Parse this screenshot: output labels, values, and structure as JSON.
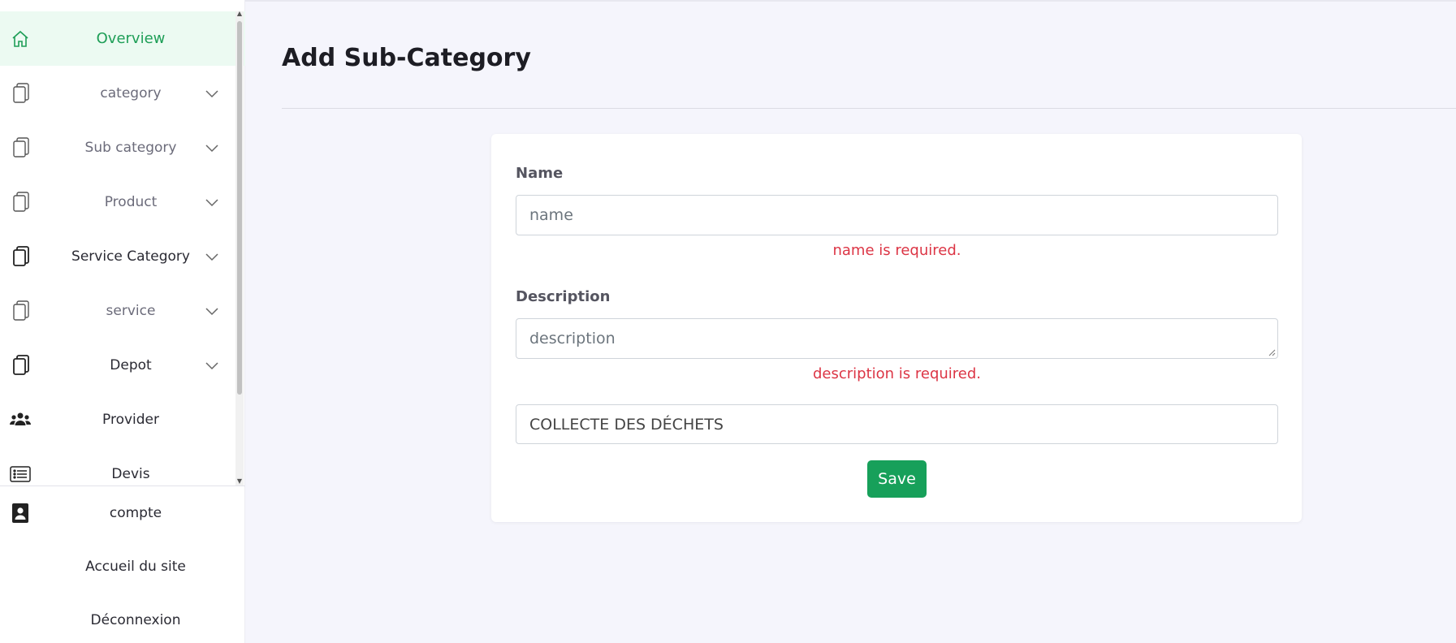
{
  "sidebar": {
    "items": [
      {
        "label": "Overview",
        "icon": "home-icon",
        "expandable": false
      },
      {
        "label": "category",
        "icon": "document-icon",
        "expandable": true
      },
      {
        "label": "Sub category",
        "icon": "document-icon",
        "expandable": true
      },
      {
        "label": "Product",
        "icon": "document-icon",
        "expandable": true
      },
      {
        "label": "Service Category",
        "icon": "document-icon",
        "expandable": true
      },
      {
        "label": "service",
        "icon": "document-icon",
        "expandable": true
      },
      {
        "label": "Depot",
        "icon": "document-icon",
        "expandable": true
      },
      {
        "label": "Provider",
        "icon": "users-icon",
        "expandable": false
      },
      {
        "label": "Devis",
        "icon": "list-icon",
        "expandable": false
      }
    ],
    "bottom_items": [
      {
        "label": "compte",
        "icon": "contact-card-icon"
      },
      {
        "label": "Accueil du site"
      },
      {
        "label": "Déconnexion"
      }
    ]
  },
  "page": {
    "title": "Add Sub-Category"
  },
  "form": {
    "name_label": "Name",
    "name_placeholder": "name",
    "name_error": "name is required.",
    "description_label": "Description",
    "description_placeholder": "description",
    "description_error": "description is required.",
    "category_value": "COLLECTE DES DÉCHETS",
    "save_label": "Save"
  },
  "colors": {
    "accent": "#17a05a",
    "active_bg": "#ecfaf2",
    "error": "#dc3545",
    "page_bg": "#f5f5fc"
  }
}
